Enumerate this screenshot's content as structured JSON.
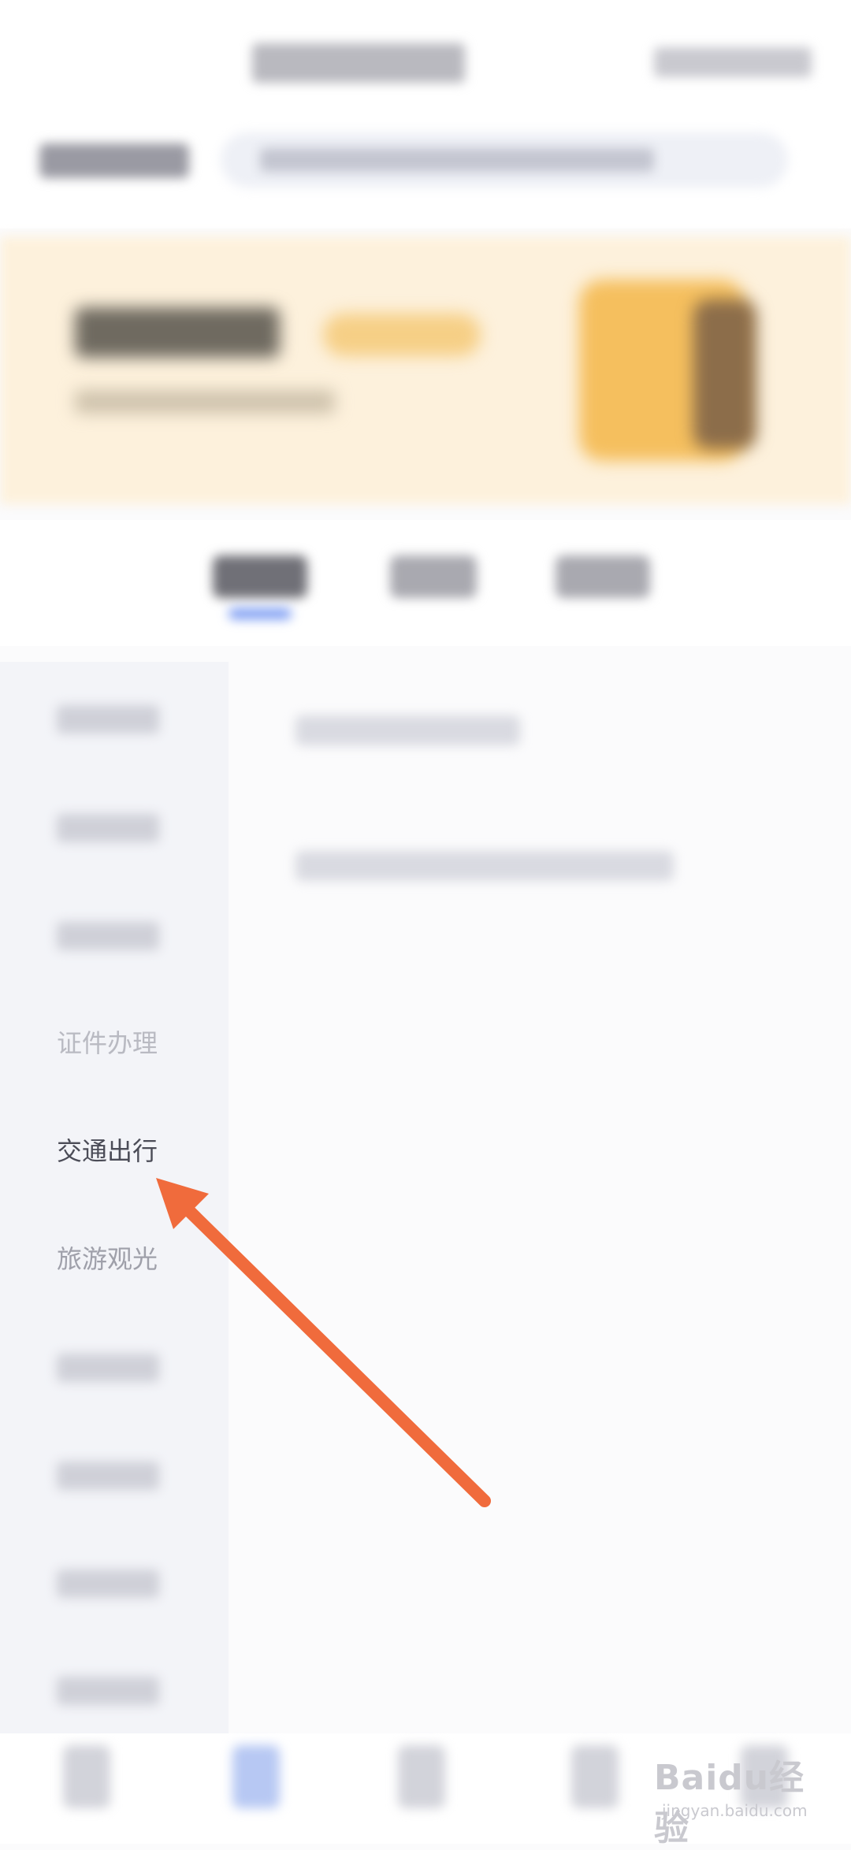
{
  "categories": {
    "visible_items": [
      {
        "label": "证件办理",
        "state": "dim"
      },
      {
        "label": "交通出行",
        "state": "active"
      },
      {
        "label": "旅游观光",
        "state": "normal"
      }
    ]
  },
  "annotation": {
    "arrow_color": "#f06b3c"
  },
  "watermark": {
    "logo": "Baidu经验",
    "url": "jingyan.baidu.com"
  },
  "colors": {
    "banner_bg": "#fdf1dc",
    "accent_blue": "#7c9cf3",
    "sidebar_bg": "#f3f4f8"
  }
}
